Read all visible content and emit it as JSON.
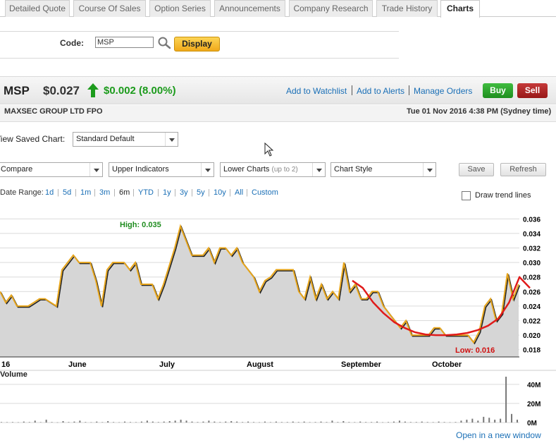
{
  "tabs": [
    {
      "label": "Detailed Quote",
      "active": false
    },
    {
      "label": "Course Of Sales",
      "active": false
    },
    {
      "label": "Option Series",
      "active": false
    },
    {
      "label": "Announcements",
      "active": false
    },
    {
      "label": "Company Research",
      "active": false
    },
    {
      "label": "Trade History",
      "active": false
    },
    {
      "label": "Charts",
      "active": true
    }
  ],
  "code_form": {
    "label": "Code:",
    "value": "MSP",
    "search_icon": "magnifier-icon",
    "display_label": "Display"
  },
  "quote": {
    "code": "MSP",
    "price": "$0.027",
    "direction_icon": "arrow-up-icon",
    "change": "$0.002 (8.00%)",
    "links": [
      "Add to Watchlist",
      "Add to Alerts",
      "Manage Orders"
    ],
    "buy_label": "Buy",
    "sell_label": "Sell",
    "company": "MAXSEC GROUP LTD FPO",
    "datetime": "Tue 01 Nov 2016 4:38 PM (Sydney time)"
  },
  "saved_chart": {
    "label": "View Saved Chart:",
    "value": "Standard Default"
  },
  "controls": {
    "compare": "Compare",
    "upper_indicators": "Upper Indicators",
    "lower_charts": "Lower Charts",
    "lower_charts_note": "(up to 2)",
    "chart_style": "Chart Style",
    "save_label": "Save",
    "refresh_label": "Refresh"
  },
  "date_range": {
    "label": "Date Range:",
    "items": [
      "1d",
      "5d",
      "1m",
      "3m",
      "6m",
      "YTD",
      "1y",
      "3y",
      "5y",
      "10y",
      "All",
      "Custom"
    ],
    "active": "6m"
  },
  "trend_lines_label": "Draw trend lines",
  "colors": {
    "price_line": "#e8a61c",
    "trend_line": "#e01b1b",
    "high": "#1e8c1e",
    "low": "#d01010",
    "area_fill": "#d6d6d6",
    "up": "#1c9b1c"
  },
  "chart_data": {
    "type": "area",
    "price_panel": {
      "y_ticks": [
        "0.036",
        "0.034",
        "0.032",
        "0.030",
        "0.028",
        "0.026",
        "0.024",
        "0.022",
        "0.020",
        "0.018"
      ],
      "ylim": [
        0.017,
        0.037
      ],
      "x_ticks": [
        "16",
        "June",
        "July",
        "August",
        "September",
        "October"
      ],
      "high_label": "High: 0.035",
      "low_label": "Low: 0.016",
      "close": [
        0.026,
        0.0245,
        0.0255,
        0.024,
        0.024,
        0.024,
        0.0245,
        0.025,
        0.025,
        0.0245,
        0.024,
        0.029,
        0.03,
        0.031,
        0.03,
        0.03,
        0.03,
        0.0275,
        0.024,
        0.029,
        0.03,
        0.03,
        0.03,
        0.029,
        0.03,
        0.027,
        0.027,
        0.027,
        0.025,
        0.027,
        0.0295,
        0.032,
        0.035,
        0.033,
        0.031,
        0.031,
        0.031,
        0.032,
        0.03,
        0.032,
        0.032,
        0.031,
        0.032,
        0.03,
        0.029,
        0.028,
        0.026,
        0.0275,
        0.028,
        0.029,
        0.029,
        0.029,
        0.029,
        0.026,
        0.025,
        0.028,
        0.025,
        0.027,
        0.025,
        0.026,
        0.025,
        0.03,
        0.026,
        0.027,
        0.025,
        0.025,
        0.026,
        0.026,
        0.024,
        0.023,
        0.022,
        0.021,
        0.022,
        0.02,
        0.02,
        0.02,
        0.02,
        0.021,
        0.021,
        0.02,
        0.02,
        0.02,
        0.02,
        0.02,
        0.019,
        0.0205,
        0.024,
        0.025,
        0.022,
        0.023,
        0.0285,
        0.025,
        0.027
      ],
      "trend_line": [
        0.0275,
        0.0265,
        0.0245,
        0.023,
        0.0218,
        0.021,
        0.0204,
        0.0201,
        0.02,
        0.02,
        0.0201,
        0.0203,
        0.0207,
        0.0213,
        0.0223,
        0.0245,
        0.028,
        0.0265
      ]
    },
    "volume_panel": {
      "title": "Volume",
      "y_ticks": [
        "40M",
        "20M",
        "0M"
      ],
      "ylim": [
        0,
        48
      ],
      "values": [
        0.5,
        0.4,
        0.5,
        0.3,
        1,
        0.5,
        2,
        0.4,
        3,
        0.5,
        0.2,
        1.5,
        0.5,
        1,
        2,
        0.5,
        0.3,
        1,
        0.4,
        1.5,
        0.5,
        0.3,
        1,
        0.5,
        0.4,
        1,
        2,
        1,
        0.5,
        1,
        1.5,
        2,
        3,
        2,
        1,
        0.5,
        1,
        2,
        1,
        0.5,
        1,
        1.5,
        1,
        0.5,
        1,
        0.5,
        0.3,
        1,
        0.4,
        1,
        0.5,
        0.5,
        1,
        0.5,
        1,
        0.4,
        0.5,
        1,
        0.5,
        2,
        0.5,
        1.5,
        0.5,
        0.4,
        1,
        0.5,
        0.5,
        1,
        0.3,
        0.5,
        1,
        2,
        1,
        0.5,
        0.5,
        1,
        0.5,
        0.4,
        1,
        0.5,
        0.3,
        0.5,
        2,
        3,
        4,
        2,
        6,
        5,
        3,
        4,
        48,
        9,
        3
      ]
    }
  },
  "open_new_window": "Open in a new window"
}
